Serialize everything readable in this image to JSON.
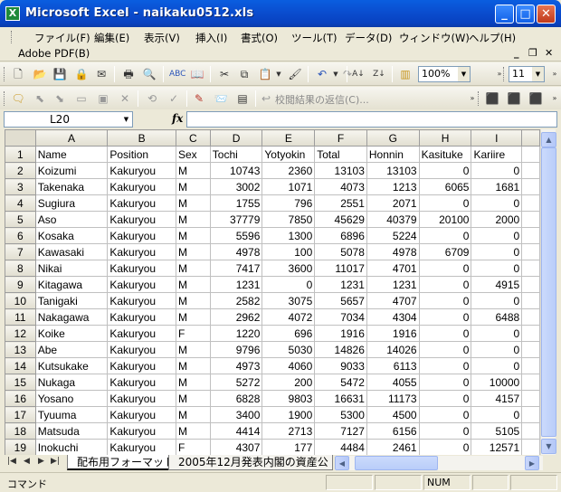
{
  "window": {
    "title": "Microsoft Excel - naikaku0512.xls",
    "app_icon": "excel-icon"
  },
  "window_controls": {
    "minimize": "_",
    "maximize": "□",
    "close": "✕"
  },
  "menu": {
    "items": [
      "ファイル(F)",
      "編集(E)",
      "表示(V)",
      "挿入(I)",
      "書式(O)",
      "ツール(T)",
      "データ(D)",
      "ウィンドウ(W)",
      "ヘルプ(H)"
    ],
    "addin": "Adobe PDF(B)",
    "doc_controls": {
      "minimize": "_",
      "restore": "❐",
      "close": "✕"
    }
  },
  "toolbar": {
    "zoom": "100%",
    "font_size": "11",
    "review_reply": "校閲結果の返信(C)..."
  },
  "formula_bar": {
    "name_box": "L20",
    "fx": "fx",
    "formula": ""
  },
  "sheet": {
    "columns": [
      "A",
      "B",
      "C",
      "D",
      "E",
      "F",
      "G",
      "H",
      "I"
    ],
    "rows": [
      {
        "n": "1",
        "cells": [
          "Name",
          "Position",
          "Sex",
          "Tochi",
          "Yotyokin",
          "Total",
          "Honnin",
          "Kasituke",
          "Kariire"
        ]
      },
      {
        "n": "2",
        "cells": [
          "Koizumi",
          "Kakuryou",
          "M",
          "10743",
          "2360",
          "13103",
          "13103",
          "0",
          "0"
        ]
      },
      {
        "n": "3",
        "cells": [
          "Takenaka",
          "Kakuryou",
          "M",
          "3002",
          "1071",
          "4073",
          "1213",
          "6065",
          "1681"
        ]
      },
      {
        "n": "4",
        "cells": [
          "Sugiura",
          "Kakuryou",
          "M",
          "1755",
          "796",
          "2551",
          "2071",
          "0",
          "0"
        ]
      },
      {
        "n": "5",
        "cells": [
          "Aso",
          "Kakuryou",
          "M",
          "37779",
          "7850",
          "45629",
          "40379",
          "20100",
          "2000"
        ]
      },
      {
        "n": "6",
        "cells": [
          "Kosaka",
          "Kakuryou",
          "M",
          "5596",
          "1300",
          "6896",
          "5224",
          "0",
          "0"
        ]
      },
      {
        "n": "7",
        "cells": [
          "Kawasaki",
          "Kakuryou",
          "M",
          "4978",
          "100",
          "5078",
          "4978",
          "6709",
          "0"
        ]
      },
      {
        "n": "8",
        "cells": [
          "Nikai",
          "Kakuryou",
          "M",
          "7417",
          "3600",
          "11017",
          "4701",
          "0",
          "0"
        ]
      },
      {
        "n": "9",
        "cells": [
          "Kitagawa",
          "Kakuryou",
          "M",
          "1231",
          "0",
          "1231",
          "1231",
          "0",
          "4915"
        ]
      },
      {
        "n": "10",
        "cells": [
          "Tanigaki",
          "Kakuryou",
          "M",
          "2582",
          "3075",
          "5657",
          "4707",
          "0",
          "0"
        ]
      },
      {
        "n": "11",
        "cells": [
          "Nakagawa",
          "Kakuryou",
          "M",
          "2962",
          "4072",
          "7034",
          "4304",
          "0",
          "6488"
        ]
      },
      {
        "n": "12",
        "cells": [
          "Koike",
          "Kakuryou",
          "F",
          "1220",
          "696",
          "1916",
          "1916",
          "0",
          "0"
        ]
      },
      {
        "n": "13",
        "cells": [
          "Abe",
          "Kakuryou",
          "M",
          "9796",
          "5030",
          "14826",
          "14026",
          "0",
          "0"
        ]
      },
      {
        "n": "14",
        "cells": [
          "Kutsukake",
          "Kakuryou",
          "M",
          "4973",
          "4060",
          "9033",
          "6113",
          "0",
          "0"
        ]
      },
      {
        "n": "15",
        "cells": [
          "Nukaga",
          "Kakuryou",
          "M",
          "5272",
          "200",
          "5472",
          "4055",
          "0",
          "10000"
        ]
      },
      {
        "n": "16",
        "cells": [
          "Yosano",
          "Kakuryou",
          "M",
          "6828",
          "9803",
          "16631",
          "11173",
          "0",
          "4157"
        ]
      },
      {
        "n": "17",
        "cells": [
          "Tyuuma",
          "Kakuryou",
          "M",
          "3400",
          "1900",
          "5300",
          "4500",
          "0",
          "0"
        ]
      },
      {
        "n": "18",
        "cells": [
          "Matsuda",
          "Kakuryou",
          "M",
          "4414",
          "2713",
          "7127",
          "6156",
          "0",
          "5105"
        ]
      },
      {
        "n": "19",
        "cells": [
          "Inokuchi",
          "Kakuryou",
          "F",
          "4307",
          "177",
          "4484",
          "2461",
          "0",
          "12571"
        ]
      }
    ]
  },
  "sheet_tabs": [
    "配布用フォーマット",
    "2005年12月発表内閣の資産公"
  ],
  "status": {
    "mode": "コマンド",
    "num": "NUM"
  }
}
